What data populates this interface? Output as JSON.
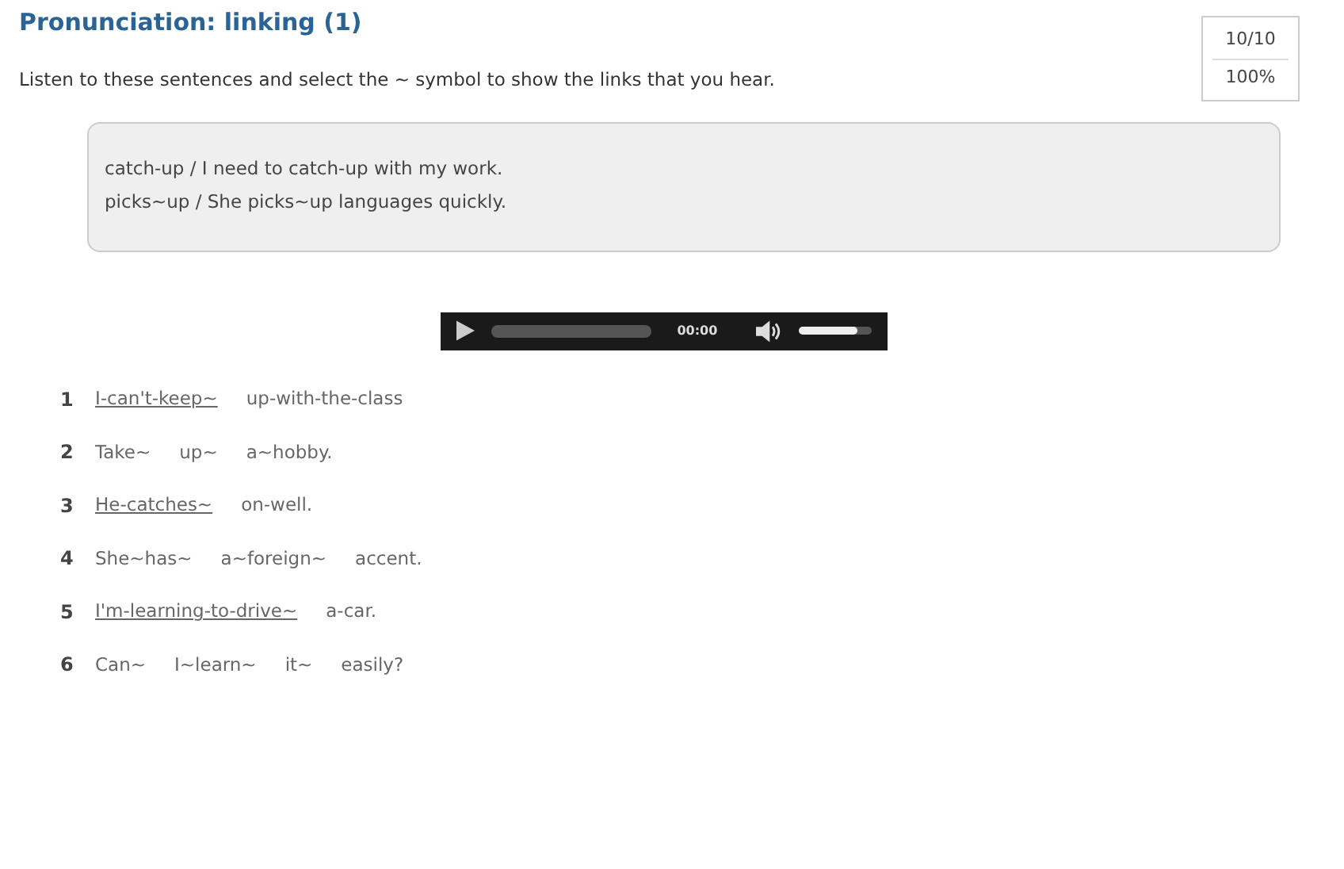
{
  "title": "Pronunciation: linking (1)",
  "instructions": "Listen to these sentences and select the ~ symbol to show the links that you hear.",
  "score": {
    "points": "10/10",
    "percent": "100%"
  },
  "examples": [
    "catch-up / I need to catch-up with my work.",
    "picks~up / She picks~up languages quickly."
  ],
  "player": {
    "time": "00:00",
    "volume": {
      "level": 0.8
    }
  },
  "sentences": [
    {
      "number": "1",
      "chunks": [
        {
          "text": "I-can't-keep~",
          "underlined": true
        },
        {
          "text": "up-with-the-class",
          "underlined": false
        }
      ]
    },
    {
      "number": "2",
      "chunks": [
        {
          "text": "Take~",
          "underlined": false
        },
        {
          "text": "up~",
          "underlined": false
        },
        {
          "text": "a~hobby.",
          "underlined": false
        }
      ]
    },
    {
      "number": "3",
      "chunks": [
        {
          "text": "He-catches~",
          "underlined": true
        },
        {
          "text": "on-well.",
          "underlined": false
        }
      ]
    },
    {
      "number": "4",
      "chunks": [
        {
          "text": "She~has~",
          "underlined": false
        },
        {
          "text": "a~foreign~",
          "underlined": false
        },
        {
          "text": "accent.",
          "underlined": false
        }
      ]
    },
    {
      "number": "5",
      "chunks": [
        {
          "text": "I'm-learning-to-drive~",
          "underlined": true
        },
        {
          "text": "a-car.",
          "underlined": false
        }
      ]
    },
    {
      "number": "6",
      "chunks": [
        {
          "text": "Can~",
          "underlined": false
        },
        {
          "text": "I~learn~",
          "underlined": false
        },
        {
          "text": "it~",
          "underlined": false
        },
        {
          "text": "easily?",
          "underlined": false
        }
      ]
    }
  ]
}
